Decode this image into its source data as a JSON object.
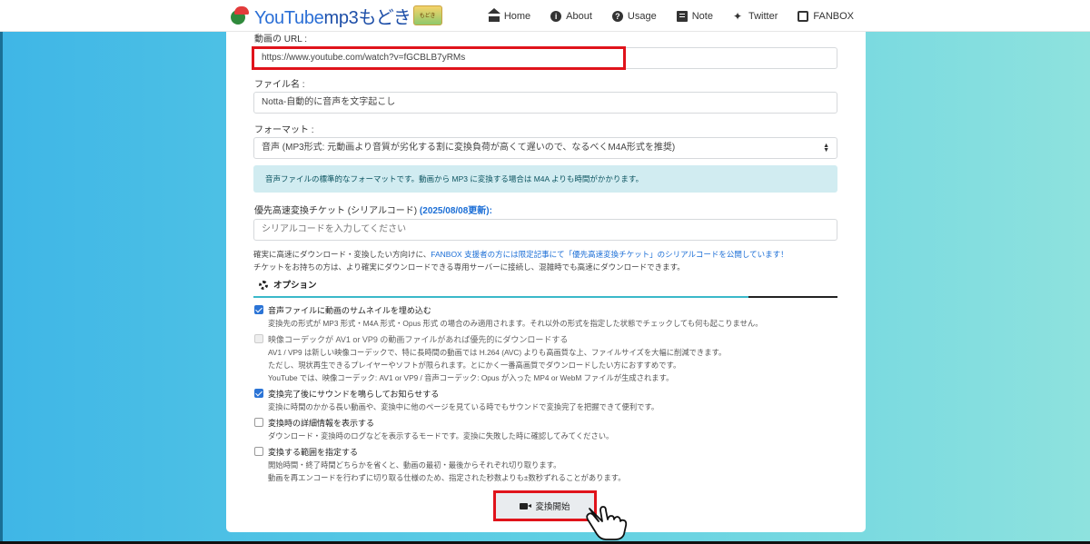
{
  "nav": {
    "logo_youtube": "YouTube",
    "logo_mp3": "mp3もどき",
    "logo_badge": "もどき",
    "items": [
      {
        "label": "Home",
        "icon": "home-icon"
      },
      {
        "label": "About",
        "icon": "info-icon"
      },
      {
        "label": "Usage",
        "icon": "question-icon"
      },
      {
        "label": "Note",
        "icon": "note-icon"
      },
      {
        "label": "Twitter",
        "icon": "twitter-icon"
      },
      {
        "label": "FANBOX",
        "icon": "fanbox-icon"
      }
    ]
  },
  "form": {
    "url_label": "動画の URL :",
    "url_value": "https://www.youtube.com/watch?v=fGCBLB7yRMs",
    "filename_label": "ファイル名 :",
    "filename_value": "Notta-自動的に音声を文字起こし",
    "format_label": "フォーマット :",
    "format_value": "音声 (MP3形式: 元動画より音質が劣化する割に変換負荷が高くて遅いので、なるべくM4A形式を推奨)",
    "format_info": "音声ファイルの標準的なフォーマットです。動画から MP3 に変換する場合は M4A よりも時間がかかります。",
    "ticket_label": "優先高速変換チケット (シリアルコード)",
    "ticket_date": "(2025/08/08更新):",
    "ticket_placeholder": "シリアルコードを入力してください",
    "notice_line1_a": "確実に高速にダウンロード・変換したい方向けに、",
    "notice_line1_link": "FANBOX 支援者の方には限定記事にて「優先高速変換チケット」のシリアルコードを公開しています！",
    "notice_line2": "チケットをお持ちの方は、より確実にダウンロードできる専用サーバーに接続し、混雑時でも高速にダウンロードできます。"
  },
  "options": {
    "heading": "オプション",
    "items": [
      {
        "title": "音声ファイルに動画のサムネイルを埋め込む",
        "checked": true,
        "desc": [
          "変換先の形式が MP3 形式・M4A 形式・Opus 形式 の場合のみ適用されます。それ以外の形式を指定した状態でチェックしても何も起こりません。"
        ]
      },
      {
        "title": "映像コーデックが AV1 or VP9 の動画ファイルがあれば優先的にダウンロードする",
        "checked": false,
        "disabled": true,
        "desc": [
          "AV1 / VP9 は新しい映像コーデックで、特に長時間の動画では H.264 (AVC) よりも高画質な上、ファイルサイズを大幅に削減できます。",
          "ただし、現状再生できるプレイヤーやソフトが限られます。とにかく一番高画質でダウンロードしたい方におすすめです。",
          "YouTube では、映像コーデック: AV1 or VP9 / 音声コーデック: Opus が入った MP4 or WebM ファイルが生成されます。"
        ]
      },
      {
        "title": "変換完了後にサウンドを鳴らしてお知らせする",
        "checked": true,
        "desc": [
          "変換に時間のかかる長い動画や、変換中に他のページを見ている時でもサウンドで変換完了を把握できて便利です。"
        ]
      },
      {
        "title": "変換時の詳細情報を表示する",
        "checked": false,
        "desc": [
          "ダウンロード・変換時のログなどを表示するモードです。変換に失敗した時に確認してみてください。"
        ]
      },
      {
        "title": "変換する範囲を指定する",
        "checked": false,
        "desc": [
          "開始時間・終了時間どちらかを省くと、動画の最初・最後からそれぞれ切り取ります。",
          "動画を再エンコードを行わずに切り取る仕様のため、指定された秒数よりも±数秒ずれることがあります。"
        ]
      }
    ]
  },
  "start_button": "変換開始",
  "colors": {
    "accent_red": "#e0131b",
    "link_blue": "#1b6ed6",
    "info_bg": "#d1ecf1"
  }
}
